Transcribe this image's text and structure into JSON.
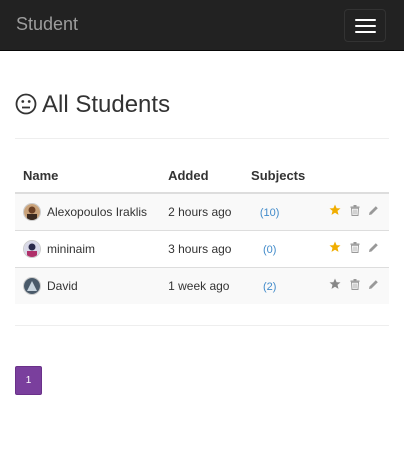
{
  "navbar": {
    "brand": "Student",
    "toggle_icon": "hamburger-menu-icon"
  },
  "page": {
    "title": "All Students",
    "title_icon": "neutral-face-icon"
  },
  "table": {
    "columns": [
      "Name",
      "Added",
      "Subjects",
      ""
    ],
    "rows": [
      {
        "name": "Alexopoulos Iraklis",
        "added": "2 hours ago",
        "subjects": "(10)",
        "favorite": true
      },
      {
        "name": "mininaim",
        "added": "3 hours ago",
        "subjects": "(0)",
        "favorite": true
      },
      {
        "name": "David",
        "added": "1 week ago",
        "subjects": "(2)",
        "favorite": false
      }
    ]
  },
  "pagination": {
    "current_page": "1"
  },
  "colors": {
    "navbar_bg": "#222222",
    "link": "#428bca",
    "star_active": "#f0ad00",
    "star_inactive": "#888888",
    "pagination_active": "#7a3f9d"
  }
}
